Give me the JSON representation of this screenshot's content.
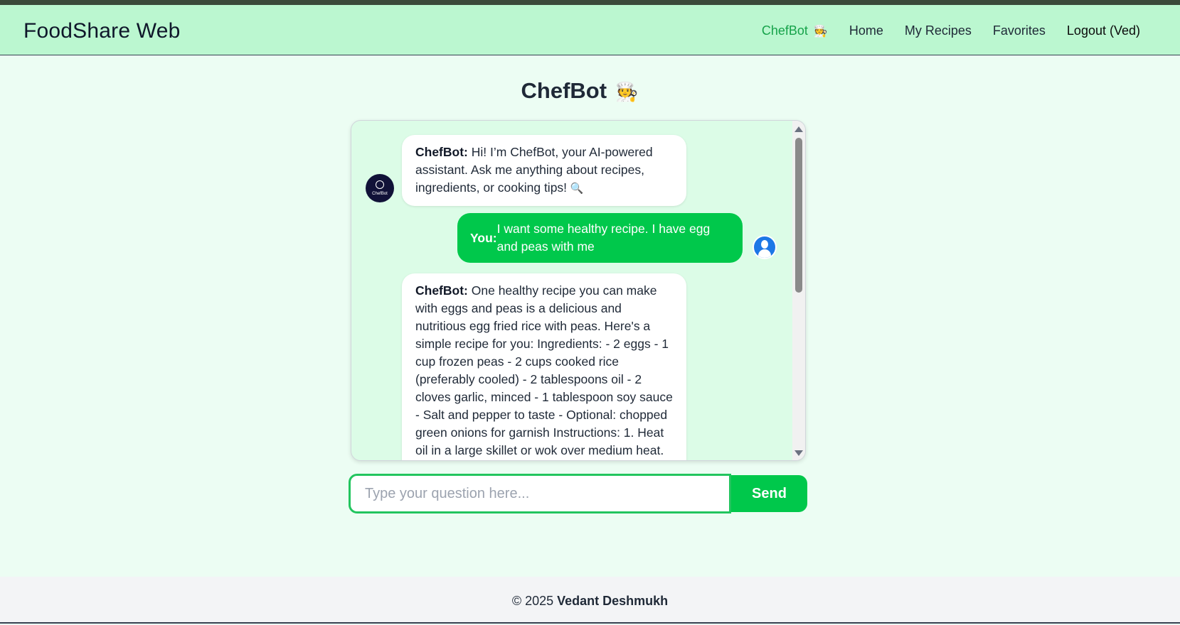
{
  "brand": "FoodShare Web",
  "nav": {
    "chefbot": "ChefBot",
    "home": "Home",
    "my_recipes": "My Recipes",
    "favorites": "Favorites",
    "logout": "Logout (Ved)"
  },
  "page_title": "ChefBot",
  "messages": [
    {
      "sender": "ChefBot:",
      "text": "Hi! I’m ChefBot, your AI-powered assistant. Ask me anything about recipes, ingredients, or cooking tips!"
    },
    {
      "sender": "You:",
      "text": "I want some healthy recipe. I have egg and peas with me"
    },
    {
      "sender": "ChefBot:",
      "text": "One healthy recipe you can make with eggs and peas is a delicious and nutritious egg fried rice with peas. Here's a simple recipe for you: Ingredients: - 2 eggs - 1 cup frozen peas - 2 cups cooked rice (preferably cooled) - 2 tablespoons oil - 2 cloves garlic, minced - 1 tablespoon soy sauce - Salt and pepper to taste - Optional: chopped green onions for garnish Instructions: 1. Heat oil in a large skillet or wok over medium heat."
    }
  ],
  "bot_avatar_label": "ChefBot",
  "input": {
    "placeholder": "Type your question here...",
    "value": ""
  },
  "send_label": "Send",
  "footer": {
    "copyright": "© 2025",
    "author": "Vedant Deshmukh"
  },
  "icons": {
    "chef": "chef-emoji",
    "search": "magnifier-emoji",
    "user_avatar": "user-icon",
    "bot_avatar": "chefbot-logo"
  },
  "colors": {
    "nav_bg": "#bbf7d0",
    "page_bg": "#ecfdf3",
    "accent": "#00c84b",
    "active_link": "#16a34a"
  }
}
